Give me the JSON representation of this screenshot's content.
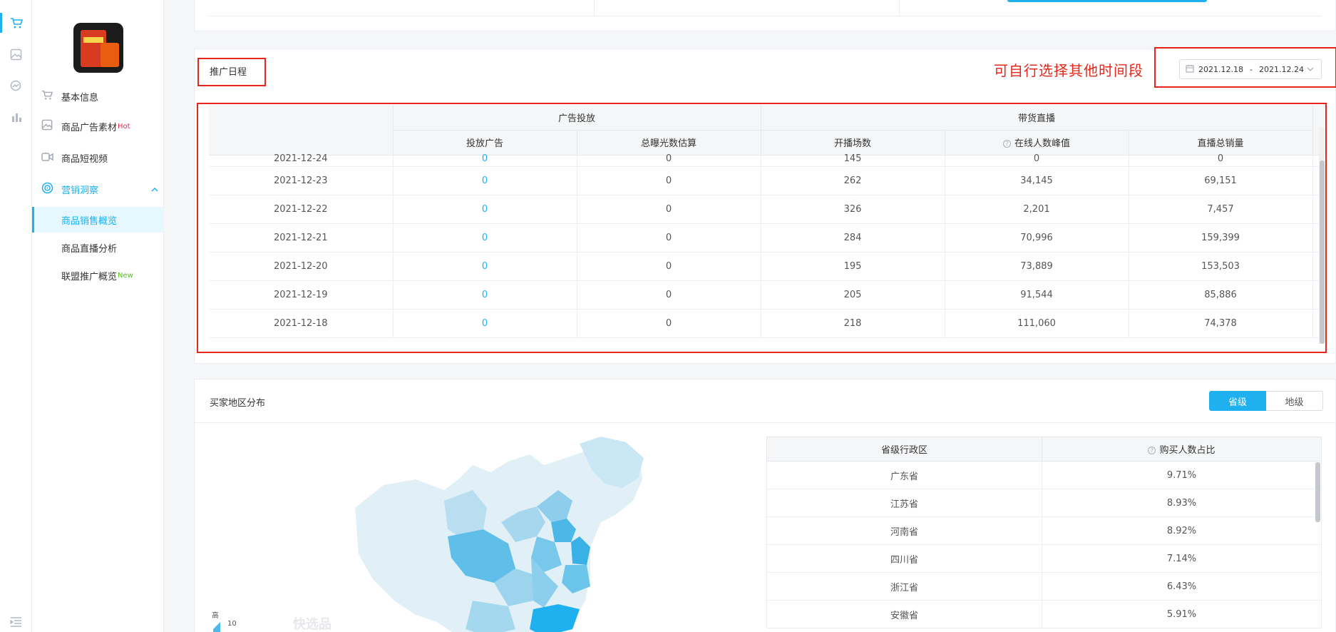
{
  "rail": {
    "icons": [
      "cart-icon",
      "image-icon",
      "chart-search-icon",
      "bar-chart-icon",
      "collapse-icon"
    ]
  },
  "sidebar": {
    "items": [
      {
        "label": "基本信息",
        "icon": "cart-icon"
      },
      {
        "label": "商品广告素材",
        "badge": "Hot",
        "icon": "image-icon"
      },
      {
        "label": "商品短视频",
        "icon": "video-icon"
      },
      {
        "label": "营销洞察",
        "icon": "insight-icon"
      }
    ],
    "subitems": [
      {
        "label": "商品销售概览"
      },
      {
        "label": "商品直播分析"
      },
      {
        "label": "联盟推广概览",
        "badge": "New"
      }
    ]
  },
  "schedule": {
    "title": "推广日程",
    "hint": "可自行选择其他时间段",
    "date_start": "2021.12.18",
    "date_sep": "-",
    "date_end": "2021.12.24",
    "group_headers": [
      "广告投放",
      "带货直播"
    ],
    "columns": [
      "投放广告",
      "总曝光数估算",
      "开播场数",
      "在线人数峰值",
      "直播总销量"
    ],
    "rows": [
      {
        "date": "2021-12-24",
        "ads": "0",
        "exposure": "0",
        "sessions": "145",
        "peak": "0",
        "sales": "0"
      },
      {
        "date": "2021-12-23",
        "ads": "0",
        "exposure": "0",
        "sessions": "262",
        "peak": "34,145",
        "sales": "69,151"
      },
      {
        "date": "2021-12-22",
        "ads": "0",
        "exposure": "0",
        "sessions": "326",
        "peak": "2,201",
        "sales": "7,457"
      },
      {
        "date": "2021-12-21",
        "ads": "0",
        "exposure": "0",
        "sessions": "284",
        "peak": "70,996",
        "sales": "159,399"
      },
      {
        "date": "2021-12-20",
        "ads": "0",
        "exposure": "0",
        "sessions": "195",
        "peak": "73,889",
        "sales": "153,503"
      },
      {
        "date": "2021-12-19",
        "ads": "0",
        "exposure": "0",
        "sessions": "205",
        "peak": "91,544",
        "sales": "85,886"
      },
      {
        "date": "2021-12-18",
        "ads": "0",
        "exposure": "0",
        "sessions": "218",
        "peak": "111,060",
        "sales": "74,378"
      }
    ]
  },
  "region": {
    "title": "买家地区分布",
    "toggle": [
      "省级",
      "地级"
    ],
    "legend_high": "高",
    "legend_value": "10",
    "watermark": "快选品",
    "table_headers": [
      "省级行政区",
      "购买人数占比"
    ],
    "rows": [
      {
        "province": "广东省",
        "pct": "9.71%"
      },
      {
        "province": "江苏省",
        "pct": "8.93%"
      },
      {
        "province": "河南省",
        "pct": "8.92%"
      },
      {
        "province": "四川省",
        "pct": "7.14%"
      },
      {
        "province": "浙江省",
        "pct": "6.43%"
      },
      {
        "province": "安徽省",
        "pct": "5.91%"
      }
    ]
  },
  "colors": {
    "accent": "#1fb0f0",
    "annotation_red": "#e8251a"
  }
}
